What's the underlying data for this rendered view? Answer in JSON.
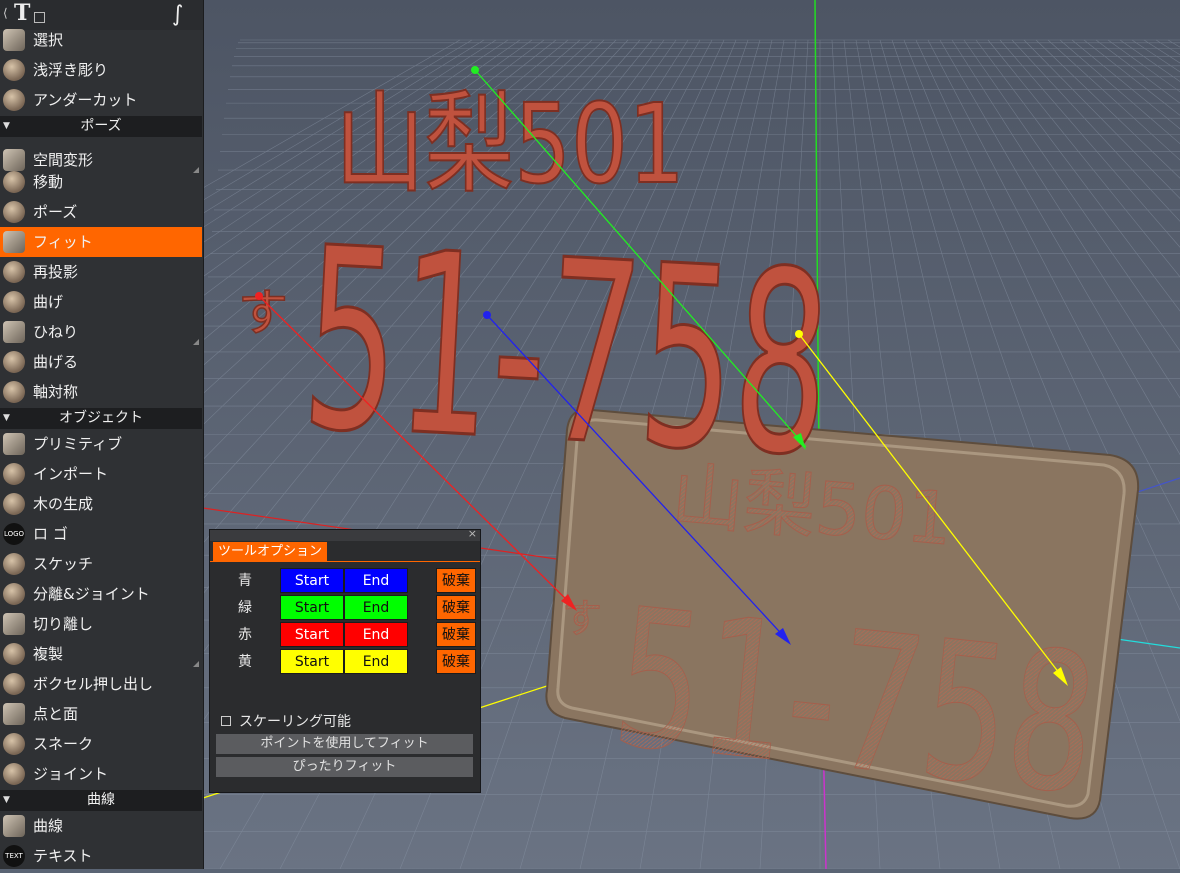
{
  "toolbar": {
    "text_tool_icon": "text-tool-icon",
    "curve_icon": "curve-stroke-icon"
  },
  "sidebar": {
    "items": [
      {
        "label": "選択",
        "icon": "select-icon"
      },
      {
        "label": "浅浮き彫り",
        "icon": "bas-relief-icon"
      },
      {
        "label": "アンダーカット",
        "icon": "undercut-icon"
      },
      {
        "label": "空間変形",
        "icon": "transform-icon"
      },
      {
        "label": "移動",
        "icon": "move-icon"
      },
      {
        "label": "ポーズ",
        "icon": "pose-icon"
      },
      {
        "label": "フィット",
        "icon": "fit-icon"
      },
      {
        "label": "再投影",
        "icon": "reproject-icon"
      },
      {
        "label": "曲げ",
        "icon": "bend-icon"
      },
      {
        "label": "ひねり",
        "icon": "twist-icon"
      },
      {
        "label": "曲げる",
        "icon": "warp-icon"
      },
      {
        "label": "軸対称",
        "icon": "axis-symmetry-icon"
      },
      {
        "label": "プリミティブ",
        "icon": "primitive-icon"
      },
      {
        "label": "インポート",
        "icon": "import-icon"
      },
      {
        "label": "木の生成",
        "icon": "tree-icon"
      },
      {
        "label": "ロ ゴ",
        "icon": "logo-icon",
        "icon_text": "LOGO"
      },
      {
        "label": "スケッチ",
        "icon": "sketch-icon"
      },
      {
        "label": "分離&ジョイント",
        "icon": "split-joint-icon"
      },
      {
        "label": "切り離し",
        "icon": "cut-icon"
      },
      {
        "label": "複製",
        "icon": "duplicate-icon"
      },
      {
        "label": "ボクセル押し出し",
        "icon": "voxel-extrude-icon"
      },
      {
        "label": "点と面",
        "icon": "point-plane-icon"
      },
      {
        "label": "スネーク",
        "icon": "snake-icon"
      },
      {
        "label": "ジョイント",
        "icon": "joint-icon"
      },
      {
        "label": "曲線",
        "icon": "curve-icon"
      },
      {
        "label": "テキスト",
        "icon": "text-icon",
        "icon_text": "TEXT"
      }
    ],
    "sections": [
      "ポーズ",
      "オブジェクト",
      "曲線"
    ],
    "active_item": "フィット",
    "accent": "#ff6600"
  },
  "scene": {
    "top_line1": "山梨501",
    "top_line2": "51-758",
    "top_kana": "す",
    "plate_line1": "山梨501",
    "plate_line2": "51-758",
    "plate_kana": "す",
    "text_color": "#c0523e",
    "plate_color": "#8a7560"
  },
  "tool_options": {
    "tab_title": "ツールオプション",
    "rows": [
      {
        "color_label": "青",
        "start": "Start",
        "end": "End",
        "discard": "破棄",
        "color": "#0000ff",
        "text_color": "#ffffff"
      },
      {
        "color_label": "緑",
        "start": "Start",
        "end": "End",
        "discard": "破棄",
        "color": "#00ff00",
        "text_color": "#111111"
      },
      {
        "color_label": "赤",
        "start": "Start",
        "end": "End",
        "discard": "破棄",
        "color": "#ff0000",
        "text_color": "#ffffff"
      },
      {
        "color_label": "黄",
        "start": "Start",
        "end": "End",
        "discard": "破棄",
        "color": "#ffff00",
        "text_color": "#111111"
      }
    ],
    "scaling_label": "スケーリング可能",
    "scaling_checked": false,
    "fit_points_button": "ポイントを使用してフィット",
    "snug_fit_button": "ぴったりフィット"
  }
}
